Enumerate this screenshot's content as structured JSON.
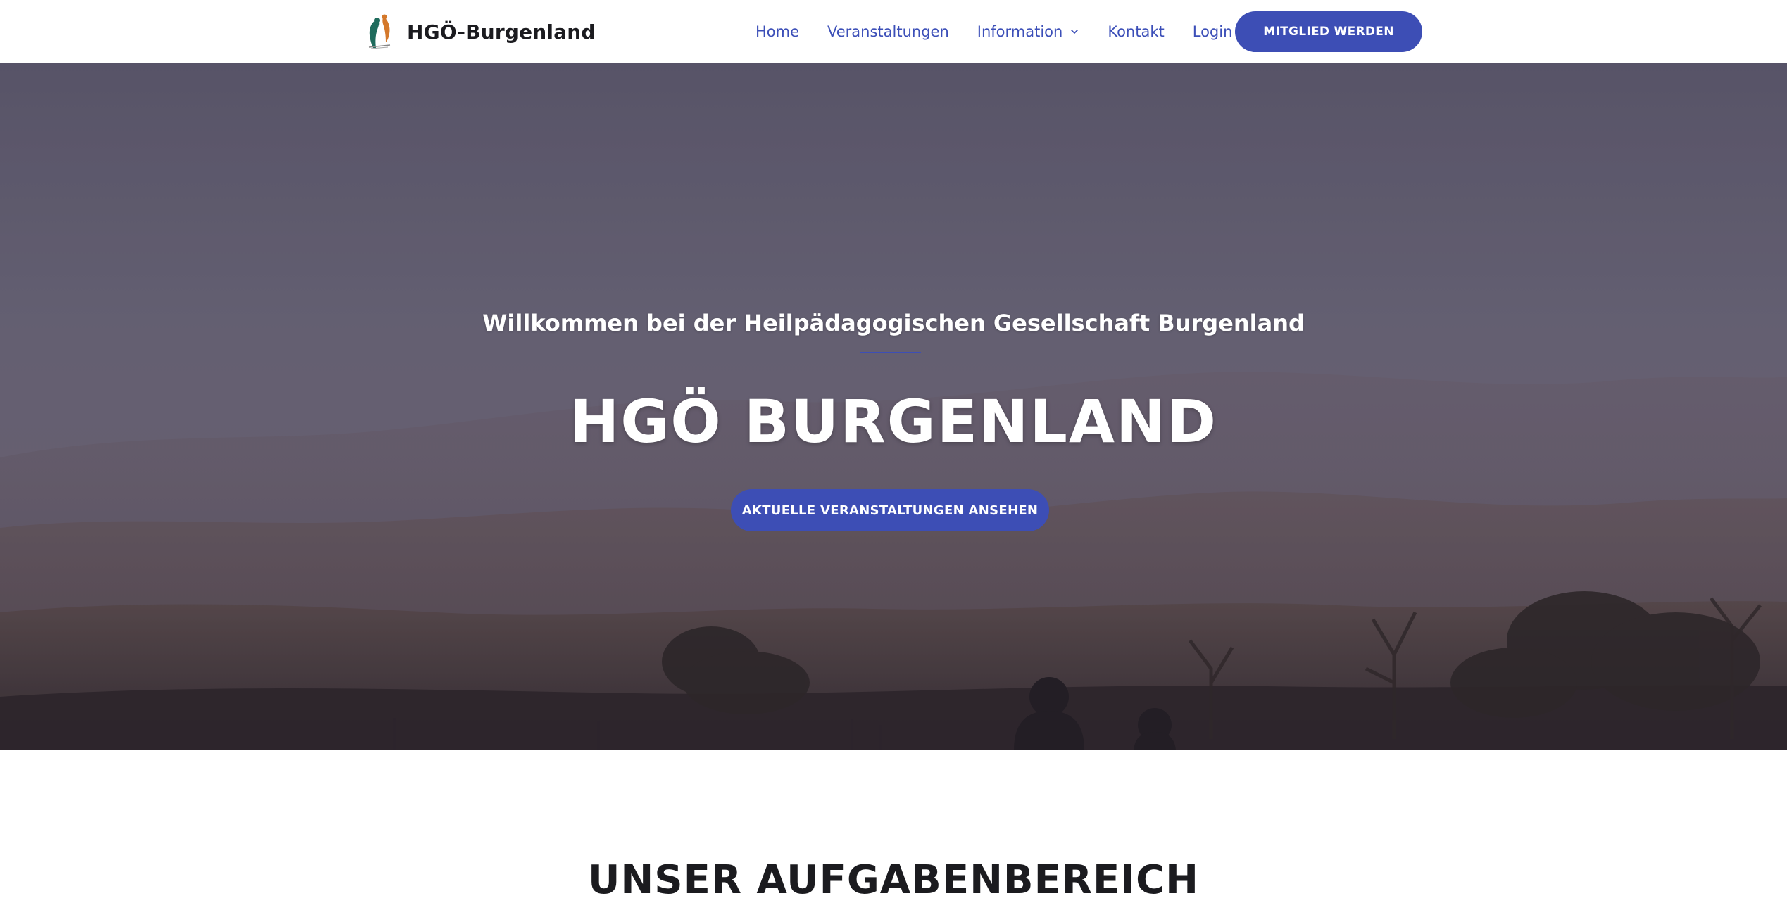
{
  "header": {
    "brand_name": "HGÖ-Burgenland",
    "nav": [
      {
        "label": "Home"
      },
      {
        "label": "Veranstaltungen"
      },
      {
        "label": "Information"
      },
      {
        "label": "Kontakt"
      },
      {
        "label": "Login"
      }
    ],
    "cta_label": "MITGLIED WERDEN"
  },
  "hero": {
    "subtitle": "Willkommen bei der Heilpädagogischen Gesellschaft Burgenland",
    "title": "HGÖ BURGENLAND",
    "cta_label": "AKTUELLE VERANSTALTUNGEN ANSEHEN"
  },
  "section": {
    "title": "UNSER AUFGABENBEREICH"
  },
  "colors": {
    "accent": "#3d4eb5",
    "nav_link": "#3c4fb8",
    "brand_text": "#1b1b1f"
  },
  "icons": {
    "logo": "hgo-logo-icon",
    "dropdown": "chevron-down-icon"
  }
}
